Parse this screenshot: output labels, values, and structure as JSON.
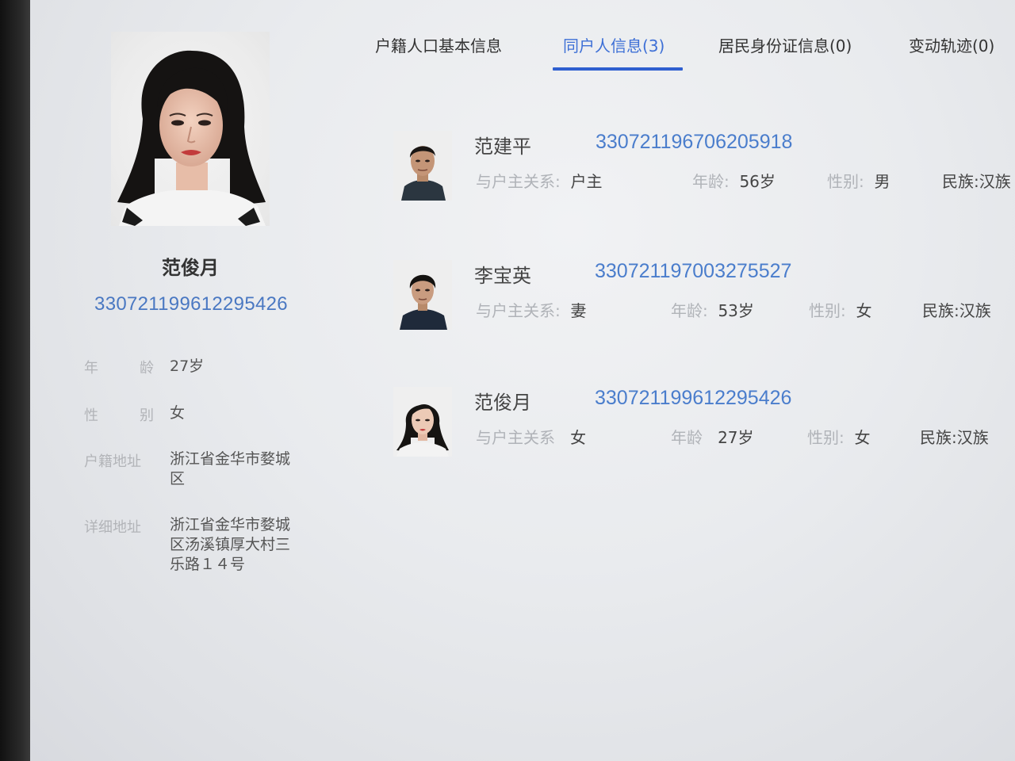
{
  "tabs": [
    {
      "label": "户籍人口基本信息",
      "active": false
    },
    {
      "label": "同户人信息(3)",
      "active": true
    },
    {
      "label": "居民身份证信息(0)",
      "active": false
    },
    {
      "label": "变动轨迹(0)",
      "active": false
    }
  ],
  "profile": {
    "name": "范俊月",
    "id_number": "330721199612295426",
    "fields": [
      {
        "label_a": "年",
        "label_b": "龄",
        "value": "27岁"
      },
      {
        "label_a": "性",
        "label_b": "别",
        "value": "女"
      },
      {
        "label": "户籍地址",
        "value": "浙江省金华市婺城区"
      },
      {
        "label": "详细地址",
        "value": "浙江省金华市婺城区汤溪镇厚大村三乐路１４号"
      }
    ]
  },
  "members": [
    {
      "name": "范建平",
      "id_number": "330721196706205918",
      "relation_label": "与户主关系",
      "relation": "户主",
      "age_label": "年龄",
      "age": "56岁",
      "gender_label": "性别",
      "gender": "男",
      "ethnicity": "民族:汉族"
    },
    {
      "name": "李宝英",
      "id_number": "330721197003275527",
      "relation_label": "与户主关系",
      "relation": "妻",
      "age_label": "年龄",
      "age": "53岁",
      "gender_label": "性别",
      "gender": "女",
      "ethnicity": "民族:汉族"
    },
    {
      "name": "范俊月",
      "id_number": "330721199612295426",
      "relation_label": "与户主关系",
      "relation": "女",
      "age_label": "年龄",
      "age": "27岁",
      "gender_label": "性别",
      "gender": "女",
      "ethnicity": "民族:汉族"
    }
  ],
  "colors": {
    "accent": "#2f5fd0",
    "link": "#4a78c2",
    "label_gray": "#b2b4b8"
  }
}
